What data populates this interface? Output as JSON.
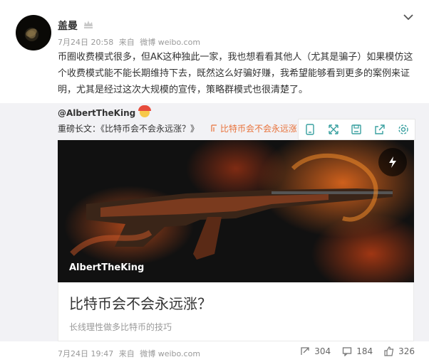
{
  "post": {
    "username": "盖曼",
    "meta": {
      "time": "7月24日 20:58",
      "from_label": "来自",
      "source": "微博 weibo.com"
    },
    "text": "币圈收费模式很多，但AK这种独此一家，我也想看看其他人（尤其是骗子）如果模仿这个收费模式能不能长期维持下去，既然这么好骗好赚，我希望能够看到更多的案例来证明，尤其是经过这次大规模的宣传，策略群模式也很清楚了。"
  },
  "repost": {
    "author": "@AlbertTheKing",
    "longtext_prefix": "重磅长文：",
    "longtext_link": "《比特币会不会永远涨？》",
    "longtext_tag": "比特币会不会永远涨",
    "media_caption": "AlbertTheKing",
    "article_title": "比特币会不会永远涨？",
    "article_subtitle": "长线理性做多比特币的技巧",
    "footer": {
      "time": "7月24日 19:47",
      "from_label": "来自",
      "source": "微博 weibo.com"
    },
    "counts": {
      "repost": "304",
      "comment": "184",
      "like": "326"
    }
  },
  "icons": {
    "crown": "crown-icon",
    "chevron": "chevron-down-icon",
    "flash": "lightning-icon",
    "toolbar": [
      "bookmark-icon",
      "expand-icon",
      "save-icon",
      "share-icon",
      "settings-icon"
    ]
  },
  "colors": {
    "accent_orange": "#e8723a",
    "repost_bg": "#f2f2f5"
  }
}
